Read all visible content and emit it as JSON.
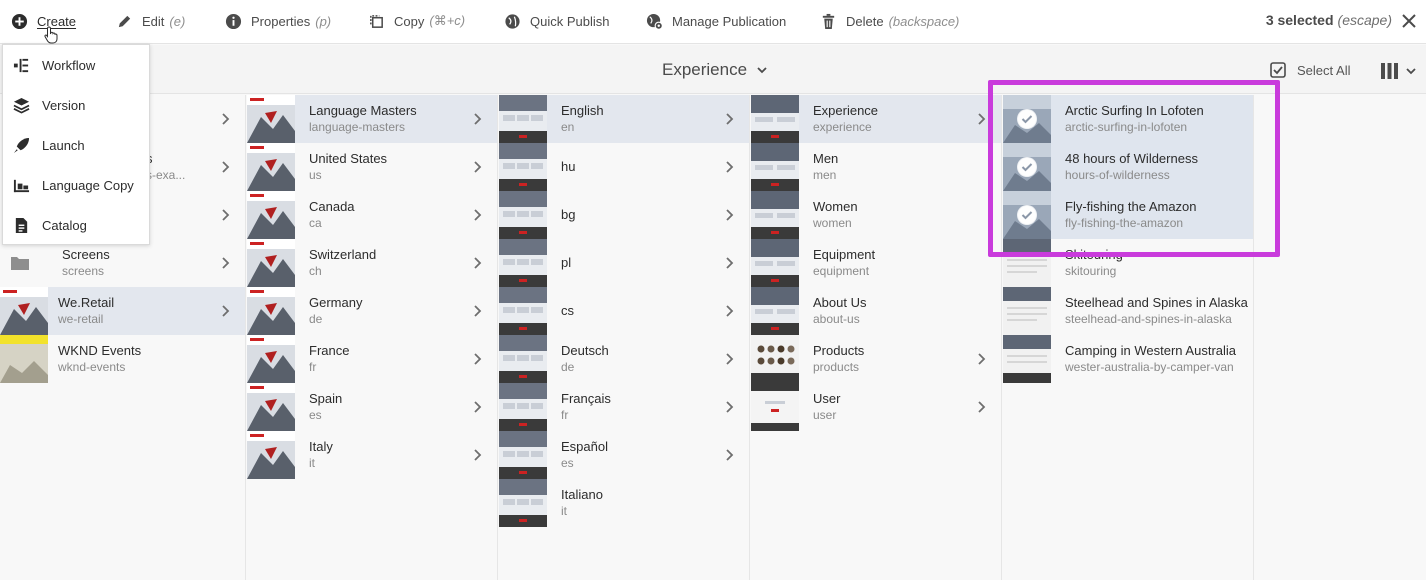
{
  "toolbar": {
    "create": "Create",
    "edit": "Edit",
    "edit_sc": "(e)",
    "properties": "Properties",
    "properties_sc": "(p)",
    "copy": "Copy",
    "copy_sc": "(⌘+c)",
    "quick_publish": "Quick Publish",
    "manage_publication": "Manage Publication",
    "delete": "Delete",
    "delete_sc": "(backspace)",
    "selected": "3 selected",
    "selected_sc": "(escape)"
  },
  "header": {
    "title": "Experience",
    "select_all": "Select All"
  },
  "create_menu": {
    "items": [
      {
        "label": "Workflow"
      },
      {
        "label": "Version"
      },
      {
        "label": "Launch"
      },
      {
        "label": "Language Copy"
      },
      {
        "label": "Catalog"
      }
    ]
  },
  "col1": {
    "items": [
      {
        "title": "",
        "name": ""
      },
      {
        "title": "s",
        "name": "s-exa..."
      },
      {
        "title": "",
        "name": ""
      },
      {
        "title": "Screens",
        "name": "screens"
      },
      {
        "title": "We.Retail",
        "name": "we-retail"
      },
      {
        "title": "WKND Events",
        "name": "wknd-events"
      }
    ]
  },
  "col2": {
    "items": [
      {
        "title": "Language Masters",
        "name": "language-masters"
      },
      {
        "title": "United States",
        "name": "us"
      },
      {
        "title": "Canada",
        "name": "ca"
      },
      {
        "title": "Switzerland",
        "name": "ch"
      },
      {
        "title": "Germany",
        "name": "de"
      },
      {
        "title": "France",
        "name": "fr"
      },
      {
        "title": "Spain",
        "name": "es"
      },
      {
        "title": "Italy",
        "name": "it"
      }
    ]
  },
  "col3": {
    "items": [
      {
        "title": "English",
        "name": "en"
      },
      {
        "title": "hu",
        "name": ""
      },
      {
        "title": "bg",
        "name": ""
      },
      {
        "title": "pl",
        "name": ""
      },
      {
        "title": "cs",
        "name": ""
      },
      {
        "title": "Deutsch",
        "name": "de"
      },
      {
        "title": "Français",
        "name": "fr"
      },
      {
        "title": "Español",
        "name": "es"
      },
      {
        "title": "Italiano",
        "name": "it"
      }
    ]
  },
  "col4": {
    "items": [
      {
        "title": "Experience",
        "name": "experience"
      },
      {
        "title": "Men",
        "name": "men"
      },
      {
        "title": "Women",
        "name": "women"
      },
      {
        "title": "Equipment",
        "name": "equipment"
      },
      {
        "title": "About Us",
        "name": "about-us"
      },
      {
        "title": "Products",
        "name": "products"
      },
      {
        "title": "User",
        "name": "user"
      }
    ]
  },
  "col5": {
    "items": [
      {
        "title": "Arctic Surfing In Lofoten",
        "name": "arctic-surfing-in-lofoten"
      },
      {
        "title": "48 hours of Wilderness",
        "name": "hours-of-wilderness"
      },
      {
        "title": "Fly-fishing the Amazon",
        "name": "fly-fishing-the-amazon"
      },
      {
        "title": "Skitouring",
        "name": "skitouring"
      },
      {
        "title": "Steelhead and Spines in Alaska",
        "name": "steelhead-and-spines-in-alaska"
      },
      {
        "title": "Camping in Western Australia",
        "name": "wester-australia-by-camper-van"
      }
    ]
  },
  "colors": {
    "accent": "#c93bdc",
    "selected_row": "#dfe5ee"
  }
}
